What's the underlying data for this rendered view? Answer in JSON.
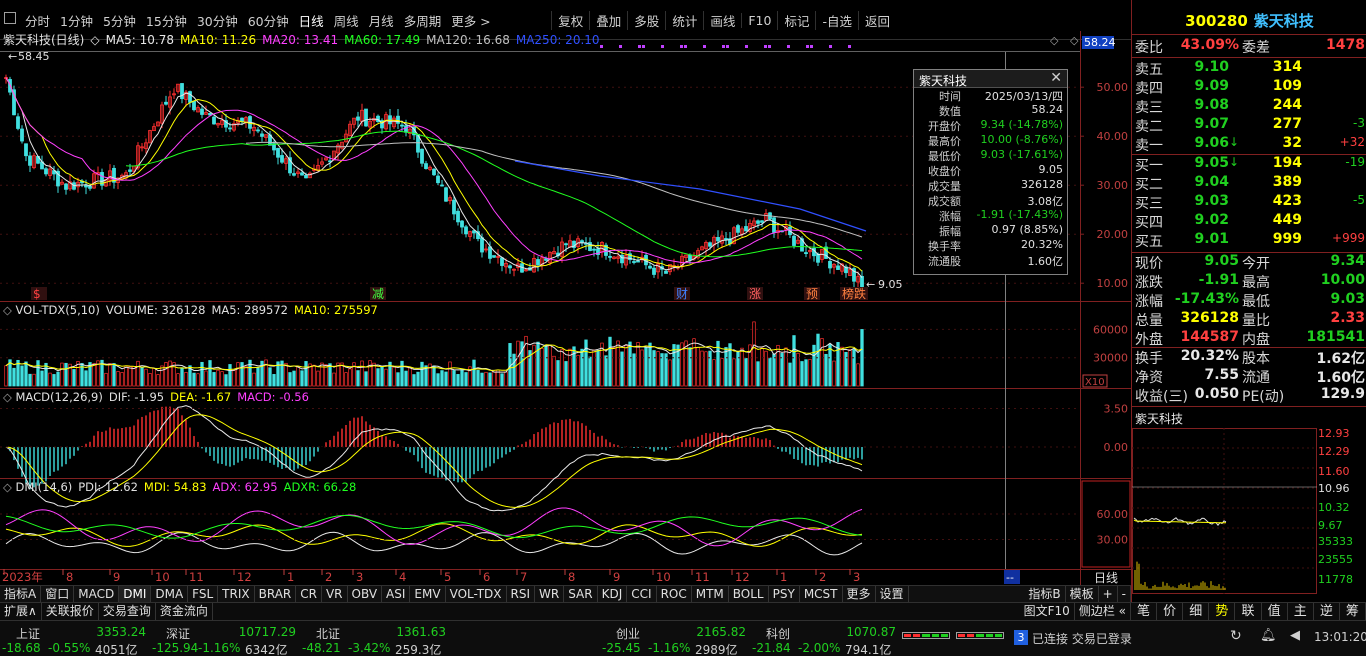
{
  "toolbar": {
    "periods": [
      "分时",
      "1分钟",
      "5分钟",
      "15分钟",
      "30分钟",
      "60分钟",
      "日线",
      "周线",
      "月线",
      "多周期",
      "更多 >"
    ],
    "active_period": "日线",
    "tools": [
      "复权",
      "叠加",
      "多股",
      "统计",
      "画线",
      "F10",
      "标记",
      "-自选",
      "返回"
    ]
  },
  "main_chart": {
    "header_name": "紫天科技(日线)",
    "ma": [
      {
        "label": "MA5: 10.78",
        "color": "#e8e8e8"
      },
      {
        "label": "MA10: 11.26",
        "color": "#ffff00"
      },
      {
        "label": "MA20: 13.41",
        "color": "#ff40ff"
      },
      {
        "label": "MA60: 17.49",
        "color": "#20ff20"
      },
      {
        "label": "MA120: 16.68",
        "color": "#c0c0c0"
      },
      {
        "label": "MA250: 20.10",
        "color": "#3050ff"
      }
    ],
    "y_ticks": [
      "50.00",
      "40.00",
      "30.00",
      "20.00",
      "10.00"
    ],
    "price_marker": "58.24",
    "high_label": "58.45",
    "low_label": "9.05",
    "events": [
      {
        "text": "$",
        "color": "#ff4040"
      },
      {
        "text": "减",
        "color": "#40ff40"
      },
      {
        "text": "财",
        "color": "#4080ff"
      },
      {
        "text": "涨",
        "color": "#ff6060"
      },
      {
        "text": "预",
        "color": "#ff8040"
      },
      {
        "text": "榜跌",
        "color": "#ff8040"
      }
    ]
  },
  "info_popup": {
    "title": "紫天科技",
    "rows": [
      {
        "k": "时间",
        "v": "2025/03/13/四",
        "c": "#e0e0e0"
      },
      {
        "k": "数值",
        "v": "58.24",
        "c": "#e0e0e0"
      },
      {
        "k": "开盘价",
        "v": "9.34 (-14.78%)",
        "c": "#20d020"
      },
      {
        "k": "最高价",
        "v": "10.00 (-8.76%)",
        "c": "#20d020"
      },
      {
        "k": "最低价",
        "v": "9.03 (-17.61%)",
        "c": "#20d020"
      },
      {
        "k": "收盘价",
        "v": "9.05",
        "c": "#e0e0e0"
      },
      {
        "k": "成交量",
        "v": "326128",
        "c": "#e0e0e0"
      },
      {
        "k": "成交额",
        "v": "3.08亿",
        "c": "#e0e0e0"
      },
      {
        "k": "涨幅",
        "v": "-1.91 (-17.43%)",
        "c": "#20d020"
      },
      {
        "k": "振幅",
        "v": "0.97 (8.85%)",
        "c": "#e0e0e0"
      },
      {
        "k": "换手率",
        "v": "20.32%",
        "c": "#e0e0e0"
      },
      {
        "k": "流通股",
        "v": "1.60亿",
        "c": "#e0e0e0"
      }
    ]
  },
  "vol_panel": {
    "header": [
      {
        "label": "VOL-TDX(5,10)",
        "color": "#e0e0e0"
      },
      {
        "label": "VOLUME: 326128",
        "color": "#e0e0e0"
      },
      {
        "label": "MA5: 289572",
        "color": "#e0e0e0"
      },
      {
        "label": "MA10: 275597",
        "color": "#ffff00"
      }
    ],
    "y_ticks": [
      "60000",
      "30000"
    ],
    "unit": "X10"
  },
  "macd_panel": {
    "header": [
      {
        "label": "MACD(12,26,9)",
        "color": "#e0e0e0"
      },
      {
        "label": "DIF: -1.95",
        "color": "#e0e0e0"
      },
      {
        "label": "DEA: -1.67",
        "color": "#ffff00"
      },
      {
        "label": "MACD: -0.56",
        "color": "#ff40ff"
      }
    ],
    "y_ticks": [
      "3.50",
      "0.00"
    ]
  },
  "dmi_panel": {
    "header": [
      {
        "label": "DMI(14,6)",
        "color": "#e0e0e0"
      },
      {
        "label": "PDI: 12.62",
        "color": "#e0e0e0"
      },
      {
        "label": "MDI: 54.83",
        "color": "#ffff00"
      },
      {
        "label": "ADX: 62.95",
        "color": "#ff40ff"
      },
      {
        "label": "ADXR: 66.28",
        "color": "#20ff20"
      }
    ],
    "y_ticks": [
      "60.00",
      "30.00"
    ]
  },
  "x_axis": {
    "labels": [
      "2023年",
      "8",
      "9",
      "10",
      "11",
      "12",
      "1",
      "2",
      "3",
      "4",
      "5",
      "6",
      "7",
      "8",
      "9",
      "10",
      "11",
      "12",
      "1",
      "2",
      "3"
    ],
    "right_label": "日线",
    "marker": "--"
  },
  "indicator_tabs": [
    "指标A",
    "窗口",
    "MACD",
    "DMI",
    "DMA",
    "FSL",
    "TRIX",
    "BRAR",
    "CR",
    "VR",
    "OBV",
    "ASI",
    "EMV",
    "VOL-TDX",
    "RSI",
    "WR",
    "SAR",
    "KDJ",
    "CCI",
    "ROC",
    "MTM",
    "BOLL",
    "PSY",
    "MCST",
    "更多",
    "设置"
  ],
  "indicator_tabs_right": [
    "指标B",
    "模板",
    "+",
    "-"
  ],
  "sub_tabs": [
    "扩展∧",
    "关联报价",
    "交易查询",
    "资金流向"
  ],
  "sub_tabs_right": [
    "图文F10",
    "侧边栏 «"
  ],
  "quote_panel": {
    "code": "300280",
    "name": "紫天科技",
    "weibi_label": "委比",
    "weibi": "43.09%",
    "weicha_label": "委差",
    "weicha": "1478",
    "asks": [
      {
        "label": "卖五",
        "price": "9.10",
        "vol": "314",
        "chg": ""
      },
      {
        "label": "卖四",
        "price": "9.09",
        "vol": "109",
        "chg": ""
      },
      {
        "label": "卖三",
        "price": "9.08",
        "vol": "244",
        "chg": ""
      },
      {
        "label": "卖二",
        "price": "9.07",
        "vol": "277",
        "chg": "-3"
      },
      {
        "label": "卖一",
        "price": "9.06",
        "vol": "32",
        "chg": "+32",
        "arrow": "↓"
      }
    ],
    "bids": [
      {
        "label": "买一",
        "price": "9.05",
        "vol": "194",
        "chg": "-19",
        "arrow": "↓"
      },
      {
        "label": "买二",
        "price": "9.04",
        "vol": "389",
        "chg": ""
      },
      {
        "label": "买三",
        "price": "9.03",
        "vol": "423",
        "chg": "-5"
      },
      {
        "label": "买四",
        "price": "9.02",
        "vol": "449",
        "chg": ""
      },
      {
        "label": "买五",
        "price": "9.01",
        "vol": "999",
        "chg": "+999"
      }
    ],
    "stats": [
      {
        "l1": "现价",
        "v1": "9.05",
        "c1": "#20d020",
        "l2": "今开",
        "v2": "9.34",
        "c2": "#20d020"
      },
      {
        "l1": "涨跌",
        "v1": "-1.91",
        "c1": "#20d020",
        "l2": "最高",
        "v2": "10.00",
        "c2": "#20d020"
      },
      {
        "l1": "涨幅",
        "v1": "-17.43%",
        "c1": "#20d020",
        "l2": "最低",
        "v2": "9.03",
        "c2": "#20d020"
      },
      {
        "l1": "总量",
        "v1": "326128",
        "c1": "#ffff00",
        "l2": "量比",
        "v2": "2.33",
        "c2": "#ff4040"
      },
      {
        "l1": "外盘",
        "v1": "144587",
        "c1": "#ff4040",
        "l2": "内盘",
        "v2": "181541",
        "c2": "#20d020"
      }
    ],
    "stats2": [
      {
        "l1": "换手",
        "v1": "20.32%",
        "l2": "股本",
        "v2": "1.62亿"
      },
      {
        "l1": "净资",
        "v1": "7.55",
        "l2": "流通",
        "v2": "1.60亿"
      },
      {
        "l1": "收益(三)",
        "v1": "0.050",
        "l2": "PE(动)",
        "v2": "129.9"
      }
    ],
    "mini_title": "紫天科技",
    "mini_prices": [
      "12.93",
      "12.29",
      "11.60",
      "10.96",
      "10.32",
      "9.67"
    ],
    "mini_vols": [
      "35333",
      "23555",
      "11778"
    ]
  },
  "rp_tabs": [
    "笔",
    "价",
    "细",
    "势",
    "联",
    "值",
    "主",
    "逆",
    "筹"
  ],
  "rp_active": "势",
  "status_bar": {
    "indices": [
      {
        "name": "上证",
        "value": "3353.24",
        "chg": "-18.68",
        "pct": "-0.55%",
        "amt": "4051亿"
      },
      {
        "name": "深证",
        "value": "10717.29",
        "chg": "-125.94",
        "pct": "-1.16%",
        "amt": "6342亿"
      },
      {
        "name": "北证",
        "value": "1361.63",
        "chg": "-48.21",
        "pct": "-3.42%",
        "amt": "259.3亿"
      },
      {
        "name": "创业",
        "value": "2165.82",
        "chg": "-25.45",
        "pct": "-1.16%",
        "amt": "2989亿"
      },
      {
        "name": "科创",
        "value": "1070.87",
        "chg": "-21.84",
        "pct": "-2.00%",
        "amt": "794.1亿"
      }
    ],
    "conn_badge": "3",
    "conn_text": "已连接 交易已登录",
    "time": "13:01:20"
  }
}
